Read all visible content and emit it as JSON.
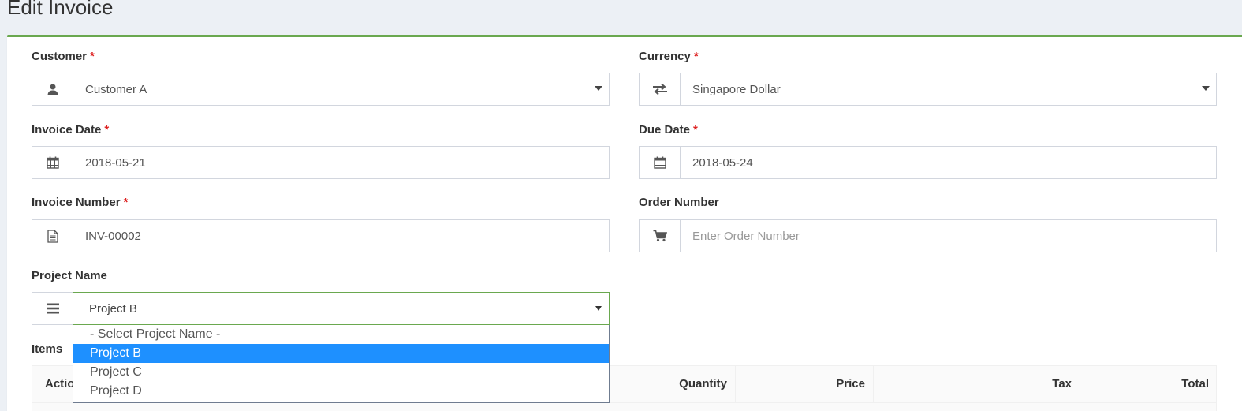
{
  "page": {
    "title": "Edit Invoice"
  },
  "form": {
    "customer": {
      "label": "Customer",
      "required": "*",
      "value": "Customer A",
      "icon": "user-icon"
    },
    "currency": {
      "label": "Currency",
      "required": "*",
      "value": "Singapore Dollar",
      "icon": "exchange-icon"
    },
    "invoice_date": {
      "label": "Invoice Date",
      "required": "*",
      "value": "2018-05-21",
      "icon": "calendar-icon"
    },
    "due_date": {
      "label": "Due Date",
      "required": "*",
      "value": "2018-05-24",
      "icon": "calendar-icon"
    },
    "invoice_number": {
      "label": "Invoice Number",
      "required": "*",
      "value": "INV-00002",
      "icon": "document-icon"
    },
    "order_number": {
      "label": "Order Number",
      "value": "",
      "placeholder": "Enter Order Number",
      "icon": "cart-icon"
    },
    "project_name": {
      "label": "Project Name",
      "value": "Project B",
      "icon": "bars-icon",
      "options": [
        "- Select Project Name -",
        "Project B",
        "Project C",
        "Project D"
      ],
      "highlighted_option": "Project B"
    }
  },
  "items": {
    "label": "Items",
    "columns": [
      "Actions",
      "Quantity",
      "Price",
      "Tax",
      "Total"
    ]
  },
  "colors": {
    "accent": "#6aa84f",
    "required": "#dd1f1f",
    "highlight": "#1e90ff"
  }
}
